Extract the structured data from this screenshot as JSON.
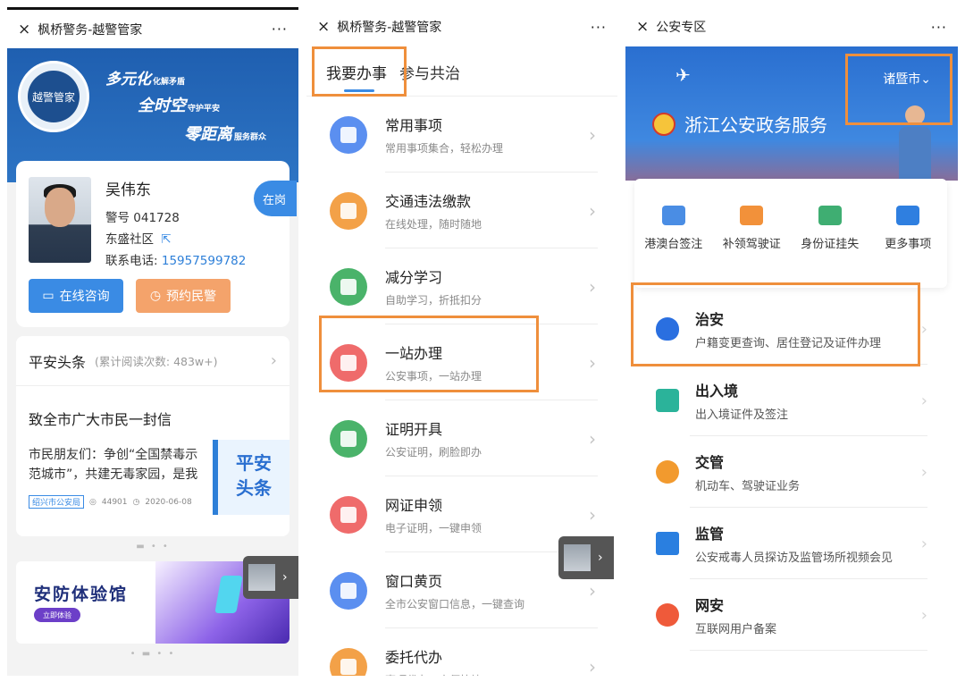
{
  "panel1": {
    "topbar": {
      "close": "×",
      "title": "枫桥警务-越警管家",
      "more": "···"
    },
    "banner": {
      "slogan1": "多元化",
      "slogan1_sub": "化解矛盾",
      "slogan2": "全时空",
      "slogan2_sub": "守护平安",
      "slogan3": "零距离",
      "slogan3_sub": "服务群众",
      "emblem_text": "越警管家"
    },
    "officer": {
      "name": "吴伟东",
      "badge_line": "警号 041728",
      "community": "东盛社区",
      "phone_label": "联系电话:",
      "phone_value": "15957599782",
      "status": "在岗",
      "consult_button": "在线咨询",
      "appointment_button": "预约民警"
    },
    "news": {
      "section_title": "平安头条",
      "read_count": "(累计阅读次数: 483w+)",
      "headline": "致全市广大市民一封信",
      "body": "市民朋友们：争创“全国禁毒示范城市”，共建无毒家园，是我",
      "source": "绍兴市公安局",
      "views": "44901",
      "date": "2020-06-08",
      "thumb_line1": "平安",
      "thumb_line2": "头条"
    },
    "promo": {
      "title": "安防体验馆",
      "button": "立即体验"
    }
  },
  "panel2": {
    "topbar": {
      "close": "×",
      "title": "枫桥警务-越警管家",
      "more": "···"
    },
    "tabs": [
      "我要办事",
      "参与共治"
    ],
    "items": [
      {
        "title": "常用事项",
        "subtitle": "常用事项集合，轻松办理",
        "color": "#5b8ff0"
      },
      {
        "title": "交通违法缴款",
        "subtitle": "在线处理，随时随地",
        "color": "#f3a148"
      },
      {
        "title": "减分学习",
        "subtitle": "自助学习，折抵扣分",
        "color": "#4ab36a"
      },
      {
        "title": "一站办理",
        "subtitle": "公安事项，一站办理",
        "color": "#ef6b6b"
      },
      {
        "title": "证明开具",
        "subtitle": "公安证明，刷脸即办",
        "color": "#4ab36a"
      },
      {
        "title": "网证申领",
        "subtitle": "电子证明，一键申领",
        "color": "#ef6b6b"
      },
      {
        "title": "窗口黄页",
        "subtitle": "全市公安窗口信息，一键查询",
        "color": "#5b8ff0"
      },
      {
        "title": "委托代办",
        "subtitle": "事项代办，方便快捷",
        "color": "#f3a148"
      }
    ]
  },
  "panel3": {
    "topbar": {
      "close": "×",
      "title": "公安专区",
      "more": "···"
    },
    "banner": {
      "title": "浙江公安政务服务",
      "city": "诸暨市⌄"
    },
    "quick_menu": [
      {
        "label": "港澳台签注",
        "color": "#4a8de4"
      },
      {
        "label": "补领驾驶证",
        "color": "#f2913a"
      },
      {
        "label": "身份证挂失",
        "color": "#3fae72"
      },
      {
        "label": "更多事项",
        "color": "#2f7fe0"
      }
    ],
    "categories": [
      {
        "title": "治安",
        "subtitle": "户籍变更查询、居住登记及证件办理",
        "color": "#2a6fe0"
      },
      {
        "title": "出入境",
        "subtitle": "出入境证件及签注",
        "color": "#2bb39a"
      },
      {
        "title": "交管",
        "subtitle": "机动车、驾驶证业务",
        "color": "#f29a2e"
      },
      {
        "title": "监管",
        "subtitle": "公安戒毒人员探访及监管场所视频会见",
        "color": "#2a7fe0"
      },
      {
        "title": "网安",
        "subtitle": "互联网用户备案",
        "color": "#ef5a3a"
      }
    ]
  }
}
